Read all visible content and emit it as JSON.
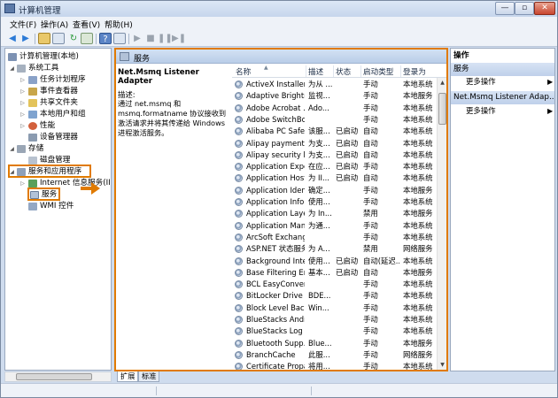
{
  "window": {
    "title": "计算机管理"
  },
  "menu": [
    "文件(F)",
    "操作(A)",
    "查看(V)",
    "帮助(H)"
  ],
  "toolbar": {
    "icons": [
      "back-icon",
      "forward-icon",
      "up-icon",
      "show-tree-icon",
      "refresh-icon",
      "export-icon",
      "help-icon",
      "properties-icon",
      "start-icon",
      "stop-icon",
      "pause-icon",
      "restart-icon"
    ]
  },
  "tree": {
    "root": "计算机管理(本地)",
    "system_tools": "系统工具",
    "task_scheduler": "任务计划程序",
    "event_viewer": "事件查看器",
    "shared_folders": "共享文件夹",
    "local_users": "本地用户和组",
    "performance": "性能",
    "device_manager": "设备管理器",
    "storage": "存储",
    "disk_management": "磁盘管理",
    "services_apps": "服务和应用程序",
    "iis": "Internet 信息服务(IIS)管",
    "services": "服务",
    "wmi": "WMI 控件"
  },
  "main": {
    "header": "服务",
    "selected_service": "Net.Msmq Listener Adapter",
    "desc_label": "描述:",
    "desc_text": "通过 net.msmq 和 msmq.formatname 协议接收到激活请求并将其传递给 Windows 进程激活服务。",
    "columns": [
      "名称",
      "描述",
      "状态",
      "启动类型",
      "登录为"
    ],
    "rows": [
      {
        "name": "ActiveX Installer ...",
        "desc": "为从 ...",
        "status": "",
        "startup": "手动",
        "logon": "本地系统"
      },
      {
        "name": "Adaptive Brightn...",
        "desc": "监视...",
        "status": "",
        "startup": "手动",
        "logon": "本地服务"
      },
      {
        "name": "Adobe Acrobat ...",
        "desc": "Ado...",
        "status": "",
        "startup": "手动",
        "logon": "本地系统"
      },
      {
        "name": "Adobe SwitchBo...",
        "desc": "",
        "status": "",
        "startup": "手动",
        "logon": "本地系统"
      },
      {
        "name": "Alibaba PC Safe ...",
        "desc": "该服...",
        "status": "已启动",
        "startup": "自动",
        "logon": "本地系统"
      },
      {
        "name": "Alipay payment ...",
        "desc": "为支...",
        "status": "已启动",
        "startup": "自动",
        "logon": "本地系统"
      },
      {
        "name": "Alipay security b...",
        "desc": "为支...",
        "status": "已启动",
        "startup": "自动",
        "logon": "本地系统"
      },
      {
        "name": "Application Expe...",
        "desc": "在应...",
        "status": "已启动",
        "startup": "手动",
        "logon": "本地系统"
      },
      {
        "name": "Application Host...",
        "desc": "为 II...",
        "status": "已启动",
        "startup": "自动",
        "logon": "本地系统"
      },
      {
        "name": "Application Iden...",
        "desc": "确定...",
        "status": "",
        "startup": "手动",
        "logon": "本地服务"
      },
      {
        "name": "Application Infor...",
        "desc": "使用...",
        "status": "",
        "startup": "手动",
        "logon": "本地系统"
      },
      {
        "name": "Application Laye...",
        "desc": "为 In...",
        "status": "",
        "startup": "禁用",
        "logon": "本地服务"
      },
      {
        "name": "Application Man...",
        "desc": "为通...",
        "status": "",
        "startup": "手动",
        "logon": "本地系统"
      },
      {
        "name": "ArcSoft Exchang...",
        "desc": "",
        "status": "",
        "startup": "手动",
        "logon": "本地系统"
      },
      {
        "name": "ASP.NET 状态服务",
        "desc": "为 A...",
        "status": "",
        "startup": "禁用",
        "logon": "网络服务"
      },
      {
        "name": "Background Inte...",
        "desc": "使用...",
        "status": "已启动",
        "startup": "自动(延迟...",
        "logon": "本地系统"
      },
      {
        "name": "Base Filtering En...",
        "desc": "基本...",
        "status": "已启动",
        "startup": "自动",
        "logon": "本地服务"
      },
      {
        "name": "BCL EasyConvert...",
        "desc": "",
        "status": "",
        "startup": "手动",
        "logon": "本地系统"
      },
      {
        "name": "BitLocker Drive ...",
        "desc": "BDE...",
        "status": "",
        "startup": "手动",
        "logon": "本地系统"
      },
      {
        "name": "Block Level Back...",
        "desc": "Win...",
        "status": "",
        "startup": "手动",
        "logon": "本地系统"
      },
      {
        "name": "BlueStacks Andr...",
        "desc": "",
        "status": "",
        "startup": "手动",
        "logon": "本地系统"
      },
      {
        "name": "BlueStacks Log ...",
        "desc": "",
        "status": "",
        "startup": "手动",
        "logon": "本地系统"
      },
      {
        "name": "Bluetooth Supp...",
        "desc": "Blue...",
        "status": "",
        "startup": "手动",
        "logon": "本地服务"
      },
      {
        "name": "BranchCache",
        "desc": "此服...",
        "status": "",
        "startup": "手动",
        "logon": "网络服务"
      },
      {
        "name": "Certificate Propa...",
        "desc": "将用...",
        "status": "",
        "startup": "手动",
        "logon": "本地系统"
      }
    ],
    "tabs": [
      "扩展",
      "标准"
    ]
  },
  "actions": {
    "header": "操作",
    "group1": "服务",
    "group1_more": "更多操作",
    "group2": "Net.Msmq Listener Adap...",
    "group2_more": "更多操作"
  },
  "colors": {
    "highlight": "#e07a00",
    "header_blue": "#bfd0ea"
  }
}
